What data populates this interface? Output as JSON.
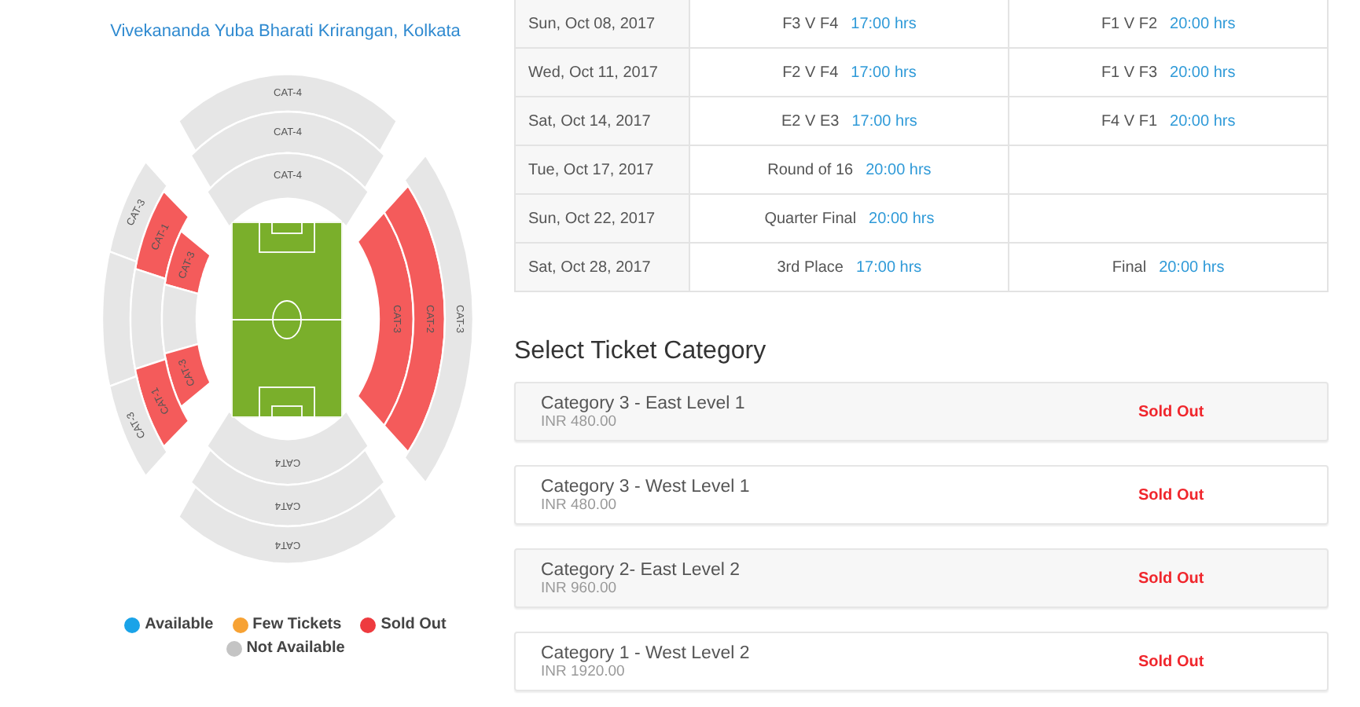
{
  "venue": {
    "title": "Vivekananda Yuba Bharati Krirangan, Kolkata"
  },
  "stadium": {
    "sections": [
      {
        "label": "CAT-4",
        "sold_out": false
      },
      {
        "label": "CAT-4",
        "sold_out": false
      },
      {
        "label": "CAT-4",
        "sold_out": false
      },
      {
        "label": "CAT-3",
        "sold_out": false
      },
      {
        "label": "CAT-1",
        "sold_out": true
      },
      {
        "label": "CAT-3",
        "sold_out": true
      },
      {
        "sold_out": false
      },
      {
        "sold_out": false
      },
      {
        "sold_out": false
      },
      {
        "label": "CAT-3",
        "sold_out": true
      },
      {
        "label": "CAT-2",
        "sold_out": true
      },
      {
        "label": "CAT-3",
        "sold_out": false
      },
      {
        "label": "CAT-3",
        "sold_out": true
      },
      {
        "label": "CAT-1",
        "sold_out": true
      },
      {
        "label": "CAT-3",
        "sold_out": false
      },
      {
        "label": "CAT4",
        "sold_out": false
      },
      {
        "label": "CAT4",
        "sold_out": false
      },
      {
        "label": "CAT4",
        "sold_out": false
      }
    ]
  },
  "legend": [
    {
      "label": "Available",
      "color": "#1aa3e8"
    },
    {
      "label": "Few Tickets",
      "color": "#f7a234"
    },
    {
      "label": "Sold Out",
      "color": "#ee3b3f"
    },
    {
      "label": "Not Available",
      "color": "#c4c4c4"
    }
  ],
  "schedule": {
    "rows": [
      {
        "date": "Sun, Oct 08, 2017",
        "matches": [
          {
            "name": "F3 V F4",
            "time": "17:00 hrs"
          },
          {
            "name": "F1 V F2",
            "time": "20:00 hrs"
          }
        ]
      },
      {
        "date": "Wed, Oct 11, 2017",
        "matches": [
          {
            "name": "F2 V F4",
            "time": "17:00 hrs"
          },
          {
            "name": "F1 V F3",
            "time": "20:00 hrs"
          }
        ]
      },
      {
        "date": "Sat, Oct 14, 2017",
        "matches": [
          {
            "name": "E2 V E3",
            "time": "17:00 hrs"
          },
          {
            "name": "F4 V F1",
            "time": "20:00 hrs"
          }
        ]
      },
      {
        "date": "Tue, Oct 17, 2017",
        "matches": [
          {
            "name": "Round of 16",
            "time": "20:00 hrs"
          }
        ]
      },
      {
        "date": "Sun, Oct 22, 2017",
        "matches": [
          {
            "name": "Quarter Final",
            "time": "20:00 hrs"
          }
        ]
      },
      {
        "date": "Sat, Oct 28, 2017",
        "matches": [
          {
            "name": "3rd Place",
            "time": "17:00 hrs"
          },
          {
            "name": "Final",
            "time": "20:00 hrs"
          }
        ]
      }
    ]
  },
  "ticket_categories": {
    "heading": "Select Ticket Category",
    "items": [
      {
        "name": "Category 3 - East Level 1",
        "price": "INR 480.00",
        "status": "Sold Out"
      },
      {
        "name": "Category 3 - West Level 1",
        "price": "INR 480.00",
        "status": "Sold Out"
      },
      {
        "name": "Category 2- East Level 2",
        "price": "INR 960.00",
        "status": "Sold Out"
      },
      {
        "name": "Category 1 - West Level 2",
        "price": "INR 1920.00",
        "status": "Sold Out"
      }
    ]
  }
}
